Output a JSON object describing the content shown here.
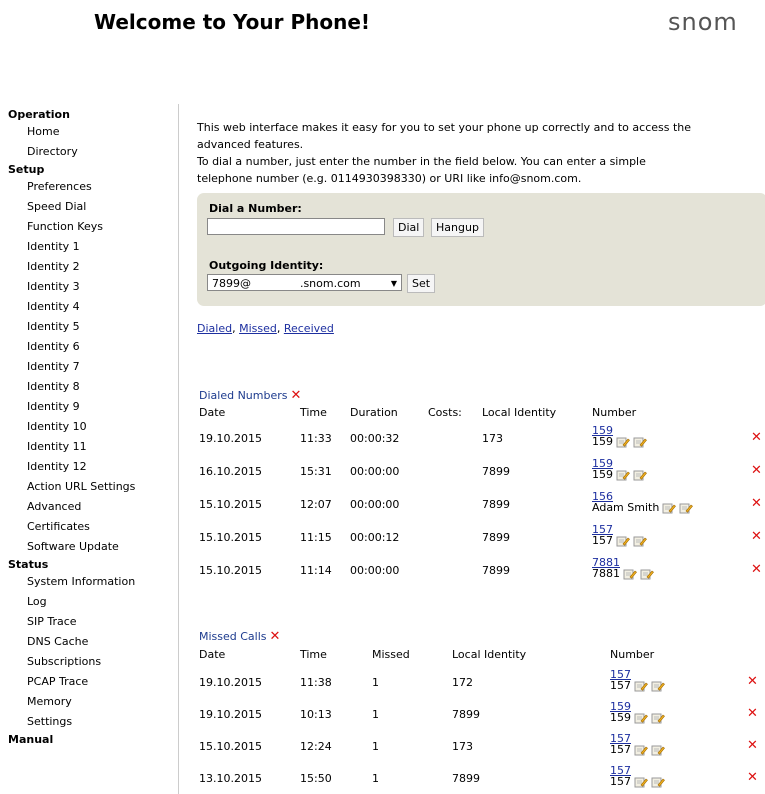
{
  "header": {
    "title": "Welcome to Your Phone!",
    "logo": "snom"
  },
  "sidebar": {
    "operation": {
      "label": "Operation",
      "items": [
        "Home",
        "Directory"
      ]
    },
    "setup": {
      "label": "Setup",
      "items": [
        "Preferences",
        "Speed Dial",
        "Function Keys",
        "Identity 1",
        "Identity 2",
        "Identity 3",
        "Identity 4",
        "Identity 5",
        "Identity 6",
        "Identity 7",
        "Identity 8",
        "Identity 9",
        "Identity 10",
        "Identity 11",
        "Identity 12",
        "Action URL Settings",
        "Advanced",
        "Certificates",
        "Software Update"
      ]
    },
    "status": {
      "label": "Status",
      "items": [
        "System Information",
        "Log",
        "SIP Trace",
        "DNS Cache",
        "Subscriptions",
        "PCAP Trace",
        "Memory",
        "Settings"
      ]
    },
    "manual": {
      "label": "Manual"
    }
  },
  "intro": {
    "line1": "This web interface makes it easy for you to set your phone up correctly and to access the",
    "line2": "advanced features.",
    "line3": "To dial a number, just enter the number in the field below. You can enter a simple",
    "line4": "telephone number (e.g. 0114930398330) or URI like info@snom.com."
  },
  "dial": {
    "label": "Dial a Number:",
    "value": "",
    "dial_button": "Dial",
    "hangup_button": "Hangup",
    "identity_label": "Outgoing Identity:",
    "identity_value": "7899@              .snom.com",
    "set_button": "Set"
  },
  "filters": {
    "dialed": "Dialed",
    "missed": "Missed",
    "received": "Received",
    "sep1": ", ",
    "sep2": ", "
  },
  "dialed": {
    "title": "Dialed Numbers",
    "headers": {
      "date": "Date",
      "time": "Time",
      "duration": "Duration",
      "costs": "Costs:",
      "identity": "Local Identity",
      "number": "Number"
    },
    "rows": [
      {
        "date": "19.10.2015",
        "time": "11:33",
        "duration": "00:00:32",
        "identity": "173",
        "link": "159",
        "name": "159"
      },
      {
        "date": "16.10.2015",
        "time": "15:31",
        "duration": "00:00:00",
        "identity": "7899",
        "link": "159",
        "name": "159"
      },
      {
        "date": "15.10.2015",
        "time": "12:07",
        "duration": "00:00:00",
        "identity": "7899",
        "link": "156",
        "name": "Adam Smith"
      },
      {
        "date": "15.10.2015",
        "time": "11:15",
        "duration": "00:00:12",
        "identity": "7899",
        "link": "157",
        "name": "157"
      },
      {
        "date": "15.10.2015",
        "time": "11:14",
        "duration": "00:00:00",
        "identity": "7899",
        "link": "7881",
        "name": "7881"
      }
    ]
  },
  "missed": {
    "title": "Missed Calls",
    "headers": {
      "date": "Date",
      "time": "Time",
      "missed": "Missed",
      "identity": "Local Identity",
      "number": "Number"
    },
    "rows": [
      {
        "date": "19.10.2015",
        "time": "11:38",
        "missed": "1",
        "identity": "172",
        "link": "157",
        "name": "157"
      },
      {
        "date": "19.10.2015",
        "time": "10:13",
        "missed": "1",
        "identity": "7899",
        "link": "159",
        "name": "159"
      },
      {
        "date": "15.10.2015",
        "time": "12:24",
        "missed": "1",
        "identity": "173",
        "link": "157",
        "name": "157"
      },
      {
        "date": "13.10.2015",
        "time": "15:50",
        "missed": "1",
        "identity": "7899",
        "link": "157",
        "name": "157"
      }
    ]
  },
  "icons": {
    "delete": "delete-x-icon",
    "edit": "edit-pencil-icon"
  },
  "colors": {
    "link": "#1d2fa0",
    "delete": "#d11111",
    "panel": "#e4e3d7",
    "section_title": "#1d3b8e"
  }
}
